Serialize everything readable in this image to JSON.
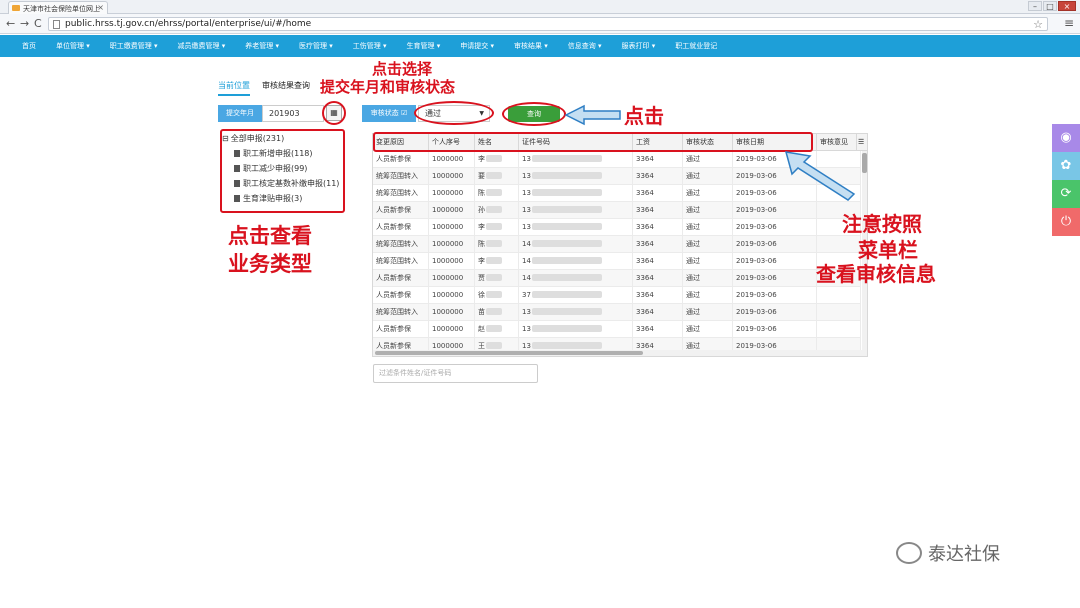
{
  "browser": {
    "tab_title": "天津市社会保险单位网上",
    "url": "public.hrss.tj.gov.cn/ehrss/portal/enterprise/ui/#/home"
  },
  "nav": {
    "items": [
      "首页",
      "单位管理 ▾",
      "职工缴费管理 ▾",
      "减员缴费管理 ▾",
      "养老管理 ▾",
      "医疗管理 ▾",
      "工伤管理 ▾",
      "生育管理 ▾",
      "申请提交 ▾",
      "审核结果 ▾",
      "信息查询 ▾",
      "服表打印 ▾",
      "职工就业登记"
    ]
  },
  "breadcrumb": {
    "current_label": "当前位置",
    "page_label": "审核结果查询"
  },
  "filters": {
    "submit_month_label": "提交年月",
    "submit_month_value": "201903",
    "status_label": "审核状态 ☑",
    "status_value": "通过",
    "query_button": "查询"
  },
  "tree": {
    "items": [
      "全部申报(231)",
      "职工新增申报(118)",
      "职工减少申报(99)",
      "职工核定基数补缴申报(11)",
      "生育津贴申报(3)"
    ]
  },
  "table": {
    "headers": [
      "变更原因",
      "个人序号",
      "姓名",
      "证件号码",
      "工资",
      "审核状态",
      "审核日期",
      "审核意见"
    ],
    "rows": [
      {
        "reason": "人员新参保",
        "seq": "1000000",
        "name": "李",
        "id": "13",
        "wage": "3364",
        "status": "通过",
        "date": "2019-03-06"
      },
      {
        "reason": "统筹范围转入",
        "seq": "1000000",
        "name": "要",
        "id": "13",
        "wage": "3364",
        "status": "通过",
        "date": "2019-03-06"
      },
      {
        "reason": "统筹范围转入",
        "seq": "1000000",
        "name": "陈",
        "id": "13",
        "wage": "3364",
        "status": "通过",
        "date": "2019-03-06"
      },
      {
        "reason": "人员新参保",
        "seq": "1000000",
        "name": "孙",
        "id": "13",
        "wage": "3364",
        "status": "通过",
        "date": "2019-03-06"
      },
      {
        "reason": "人员新参保",
        "seq": "1000000",
        "name": "李",
        "id": "13",
        "wage": "3364",
        "status": "通过",
        "date": "2019-03-06"
      },
      {
        "reason": "统筹范围转入",
        "seq": "1000000",
        "name": "陈",
        "id": "14",
        "wage": "3364",
        "status": "通过",
        "date": "2019-03-06"
      },
      {
        "reason": "统筹范围转入",
        "seq": "1000000",
        "name": "李",
        "id": "14",
        "wage": "3364",
        "status": "通过",
        "date": "2019-03-06"
      },
      {
        "reason": "人员新参保",
        "seq": "1000000",
        "name": "贾",
        "id": "14",
        "wage": "3364",
        "status": "通过",
        "date": "2019-03-06"
      },
      {
        "reason": "人员新参保",
        "seq": "1000000",
        "name": "徐",
        "id": "37",
        "wage": "3364",
        "status": "通过",
        "date": "2019-03-06"
      },
      {
        "reason": "统筹范围转入",
        "seq": "1000000",
        "name": "苗",
        "id": "13",
        "wage": "3364",
        "status": "通过",
        "date": "2019-03-06"
      },
      {
        "reason": "人员新参保",
        "seq": "1000000",
        "name": "赵",
        "id": "13",
        "wage": "3364",
        "status": "通过",
        "date": "2019-03-06"
      },
      {
        "reason": "人员新参保",
        "seq": "1000000",
        "name": "王",
        "id": "13",
        "wage": "3364",
        "status": "通过",
        "date": "2019-03-06"
      }
    ]
  },
  "search": {
    "placeholder": "过滤条件姓名/证件号码"
  },
  "annotations": {
    "select_line1": "点击选择",
    "select_line2": "提交年月和审核状态",
    "click": "点击",
    "tree_line1": "点击查看",
    "tree_line2": "业务类型",
    "menu_line1": "注意按照",
    "menu_line2": "菜单栏",
    "menu_line3": "查看审核信息"
  },
  "watermark": "泰达社保",
  "colors": {
    "accent": "#1e9fd8",
    "annotation_red": "#d9121e",
    "query_green": "#3a9e3a"
  }
}
